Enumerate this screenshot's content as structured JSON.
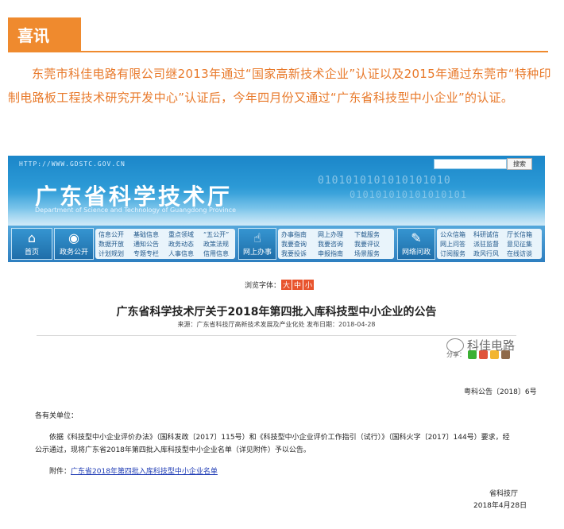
{
  "header": {
    "badge": "喜讯"
  },
  "intro": {
    "text": "东莞市科佳电路有限公司继2013年通过“国家高新技术企业”认证以及2015年通过东莞市“特种印制电路板工程技术研究开发中心”认证后，今年四月份又通过“广东省科技型中小企业”的认证。"
  },
  "site": {
    "url": "HTTP://WWW.GDSTC.GOV.CN",
    "title": "广东省科学技术厅",
    "subtitle": "Department of Science and Technology of Guangdong Province",
    "digits": "0101010101010101010",
    "digits2": "010101010101010101",
    "search_button": "搜索",
    "nav": {
      "home": "首页",
      "affairs": "政务公开",
      "online": "网上办事",
      "net_qa": "网络问政",
      "affairs_links": [
        [
          "信息公开",
          "数据开放",
          "计划规划"
        ],
        [
          "基础信息",
          "通知公告",
          "专题专栏"
        ],
        [
          "重点领域",
          "政务动态",
          "人事信息"
        ],
        [
          "“五公开”",
          "政策法规",
          "信用信息"
        ]
      ],
      "online_links": [
        [
          "办事指南",
          "我要查询",
          "我要投诉"
        ],
        [
          "网上办理",
          "我要咨询",
          "申报指南"
        ],
        [
          "下载服务",
          "我要评议",
          "场景服务"
        ]
      ],
      "qa_links": [
        [
          "公众信箱",
          "网上问答",
          "订阅服务"
        ],
        [
          "科研诚信",
          "派驻监督",
          "政风行风"
        ],
        [
          "厅长信箱",
          "意见征集",
          "在线访谈"
        ]
      ]
    },
    "font_size_label": "浏览字体：",
    "font_sizes": [
      "大",
      "中",
      "小"
    ],
    "doc": {
      "title": "广东省科学技术厅关于2018年第四批入库科技型中小企业的公告",
      "meta": "来源：广东省科技厅高新技术发展及产业化处   发布日期：2018-04-28",
      "share_label": "分享：",
      "number": "粤科公告〔2018〕6号",
      "salutation": "各有关单位：",
      "body": "依据《科技型中小企业评价办法》（国科发政〔2017〕115号）和《科技型中小企业评价工作指引（试行）》（国科火字〔2017〕144号）要求，经公示通过，现将广东省2018年第四批入库科技型中小企业名单（详见附件）予以公告。",
      "attach_label": "附件：",
      "attach_link": "广东省2018年第四批入库科技型中小企业名单",
      "signature": "省科技厅",
      "date_partial": "2018年4月28日"
    }
  },
  "watermark": {
    "text": "科佳电路"
  },
  "colors": {
    "accent": "#ef8a2e",
    "intro_text": "#e8792a",
    "banner": "#1b86c9"
  }
}
